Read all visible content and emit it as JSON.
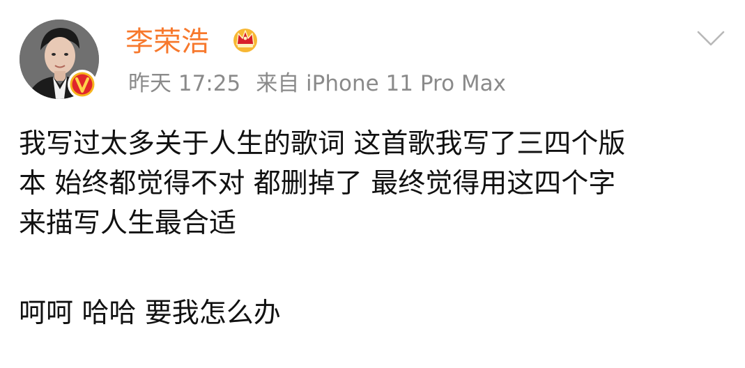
{
  "post": {
    "username": "李荣浩",
    "timestamp": "昨天 17:25",
    "source": "来自 iPhone 11 Pro Max",
    "icons": {
      "avatar": "user-avatar-photo",
      "verified": "verified-v-badge-icon",
      "member": "crown-member-icon",
      "more": "chevron-down-icon"
    },
    "colors": {
      "username": "#f7782c",
      "meta": "#8a8a8a",
      "text": "#111111",
      "verified_badge": "#e0262a",
      "crown": "#f5a623"
    },
    "body_lines": [
      "我写过太多关于人生的歌词 这首歌我写了三四个版",
      "本 始终都觉得不对 都删掉了 最终觉得用这四个字",
      "来描写人生最合适"
    ],
    "reply_line": "呵呵 哈哈 要我怎么办"
  }
}
